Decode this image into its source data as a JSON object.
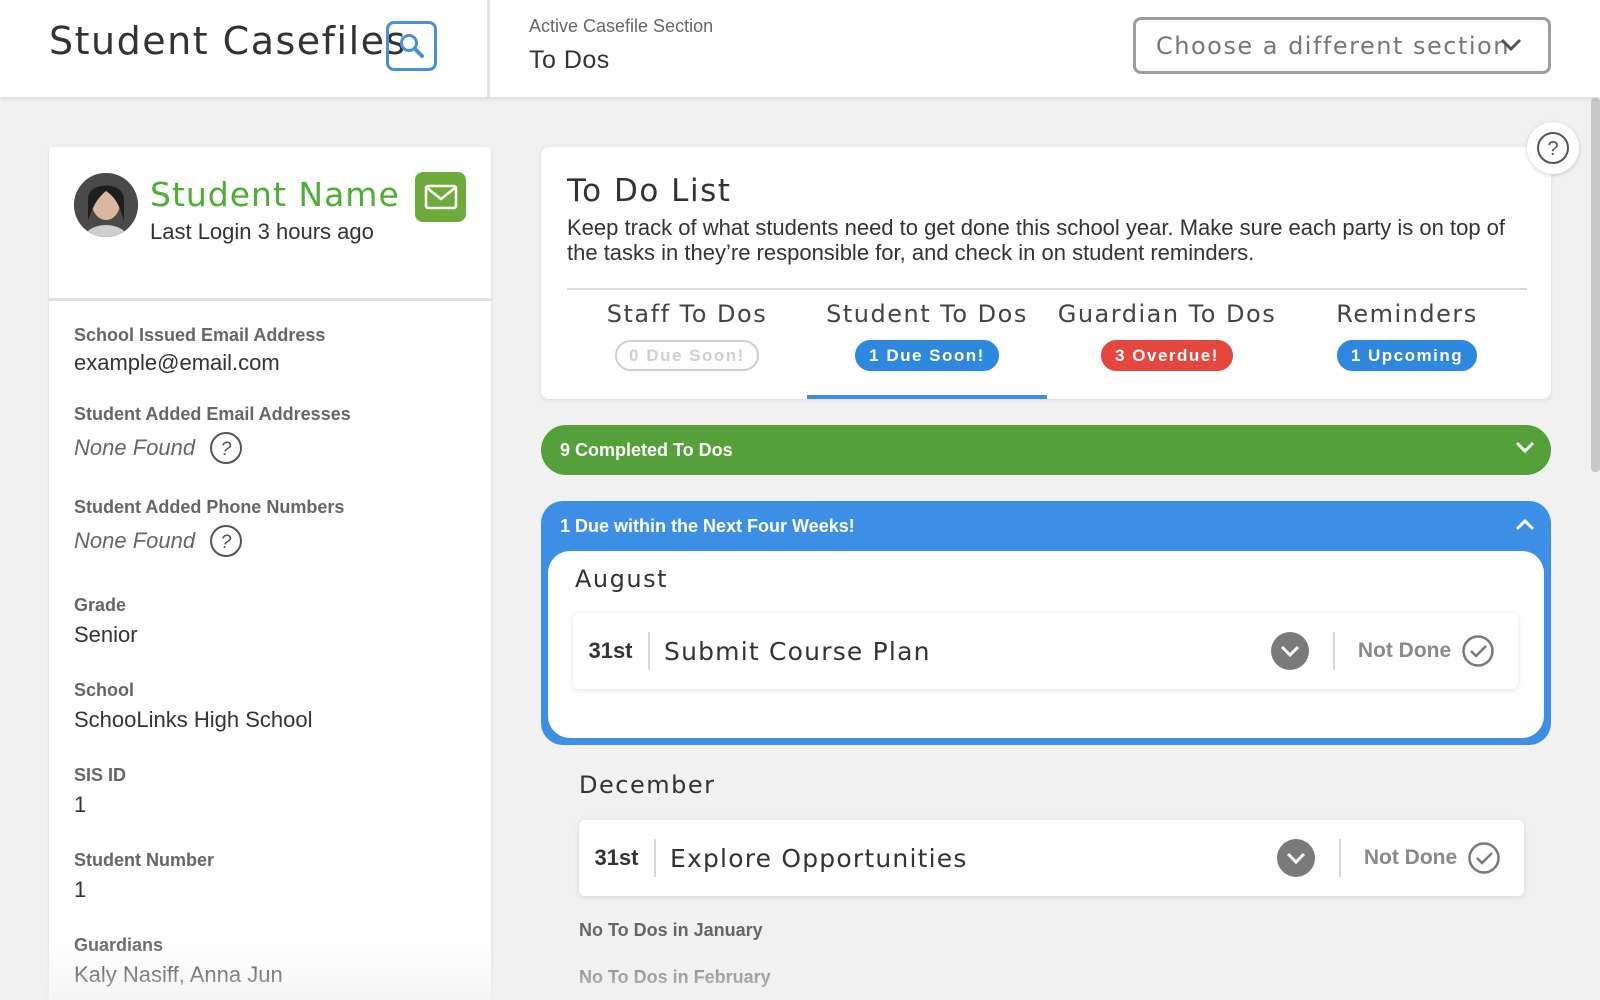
{
  "header": {
    "app_title": "Student Casefiles",
    "search_icon": "search-icon",
    "section_label": "Active Casefile Section",
    "section_value": "To Dos",
    "section_select": "Choose a different section"
  },
  "help_icon": "question-circle-icon",
  "student": {
    "name": "Student Name",
    "last_login": "Last Login 3 hours ago",
    "avatar_icon": "avatar",
    "mail_icon": "mail-icon",
    "fields": {
      "school_email": {
        "label": "School Issued Email Address",
        "value": "example@email.com"
      },
      "added_emails": {
        "label": "Student Added Email Addresses",
        "value": "None Found"
      },
      "added_phones": {
        "label": "Student Added Phone Numbers",
        "value": "None Found"
      },
      "grade": {
        "label": "Grade",
        "value": "Senior"
      },
      "school": {
        "label": "School",
        "value": "SchooLinks High School"
      },
      "sis_id": {
        "label": "SIS ID",
        "value": "1"
      },
      "student_number": {
        "label": "Student Number",
        "value": "1"
      },
      "guardians": {
        "label": "Guardians",
        "value": "Kaly Nasiff, Anna Jun"
      }
    }
  },
  "todo": {
    "title": "To Do List",
    "description": "Keep track of what students need to get done this school year. Make sure each party is on top of the tasks in they’re responsible for, and check in on student reminders.",
    "tabs": [
      {
        "label": "Staff To Dos",
        "badge": "0 Due Soon!",
        "badge_color": "#d0d0d0"
      },
      {
        "label": "Student To Dos",
        "badge": "1 Due Soon!",
        "badge_color": "#2e88e0",
        "active": true
      },
      {
        "label": "Guardian To Dos",
        "badge": "3 Overdue!",
        "badge_color": "#e4473d"
      },
      {
        "label": "Reminders",
        "badge": "1 Upcoming",
        "badge_color": "#2e88e0"
      }
    ]
  },
  "completed": {
    "label": "9 Completed To Dos",
    "color": "#55a03a"
  },
  "due_soon": {
    "label": "1 Due within the Next Four Weeks!",
    "color": "#3d8fe6",
    "month": "August",
    "items": [
      {
        "day": "31st",
        "title": "Submit Course Plan",
        "status": "Not Done"
      }
    ]
  },
  "later": {
    "month": "December",
    "items": [
      {
        "day": "31st",
        "title": "Explore Opportunities",
        "status": "Not Done"
      }
    ],
    "empty_months": [
      "No To Dos in January",
      "No To Dos in February"
    ]
  }
}
